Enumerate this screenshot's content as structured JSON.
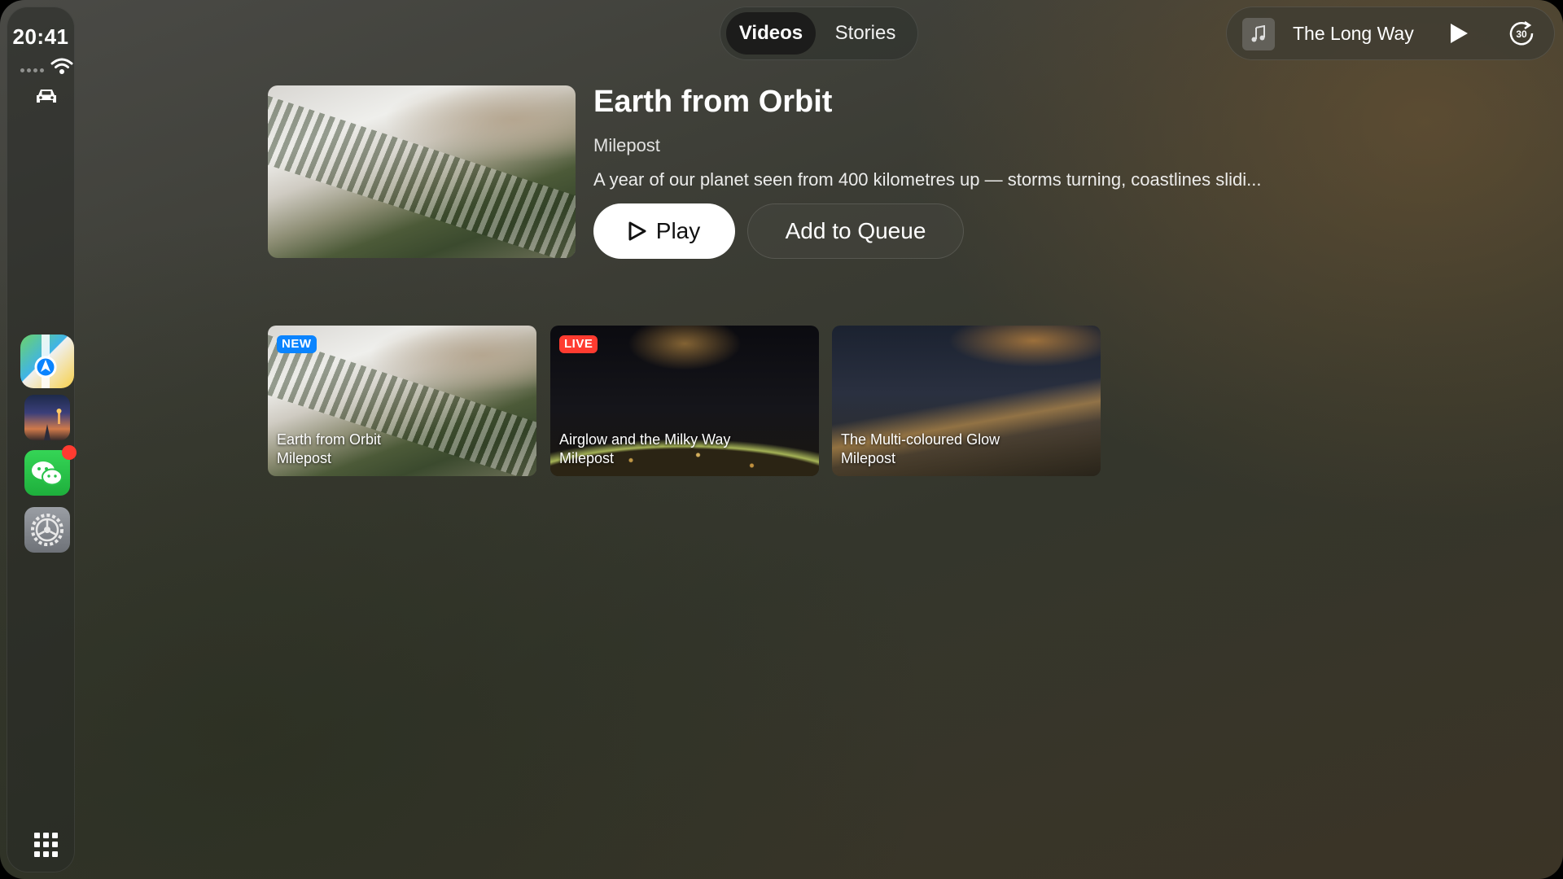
{
  "status": {
    "time": "20:41"
  },
  "dock": {
    "apps": [
      {
        "name": "Maps",
        "icon": "maps-icon"
      },
      {
        "name": "Photos",
        "icon": "photos-icon"
      },
      {
        "name": "Messages",
        "icon": "messages-icon",
        "badge": true
      },
      {
        "name": "Settings",
        "icon": "settings-icon"
      }
    ],
    "grid_icon": "app-grid-icon"
  },
  "tabs": {
    "videos": "Videos",
    "stories": "Stories",
    "active": "Videos"
  },
  "now_playing": {
    "title": "The Long Way",
    "play_icon": "play-icon",
    "skip_icon": "skip-forward-30-icon",
    "skip_label": "30"
  },
  "featured": {
    "title": "Earth from Orbit",
    "channel": "Milepost",
    "description": "A year of our planet seen from 400 kilometres up — storms turning, coastlines slidi...",
    "play_label": "Play",
    "queue_label": "Add to Queue"
  },
  "videos": [
    {
      "badge": "NEW",
      "title": "Earth from Orbit",
      "channel": "Milepost"
    },
    {
      "badge": "LIVE",
      "title": "Airglow and the Milky Way",
      "channel": "Milepost"
    },
    {
      "badge": "",
      "title": "The Multi-coloured Glow",
      "channel": "Milepost"
    }
  ],
  "colors": {
    "new_badge": "#0a84ff",
    "live_badge": "#ff3b30",
    "notification_dot": "#ff3b30"
  }
}
